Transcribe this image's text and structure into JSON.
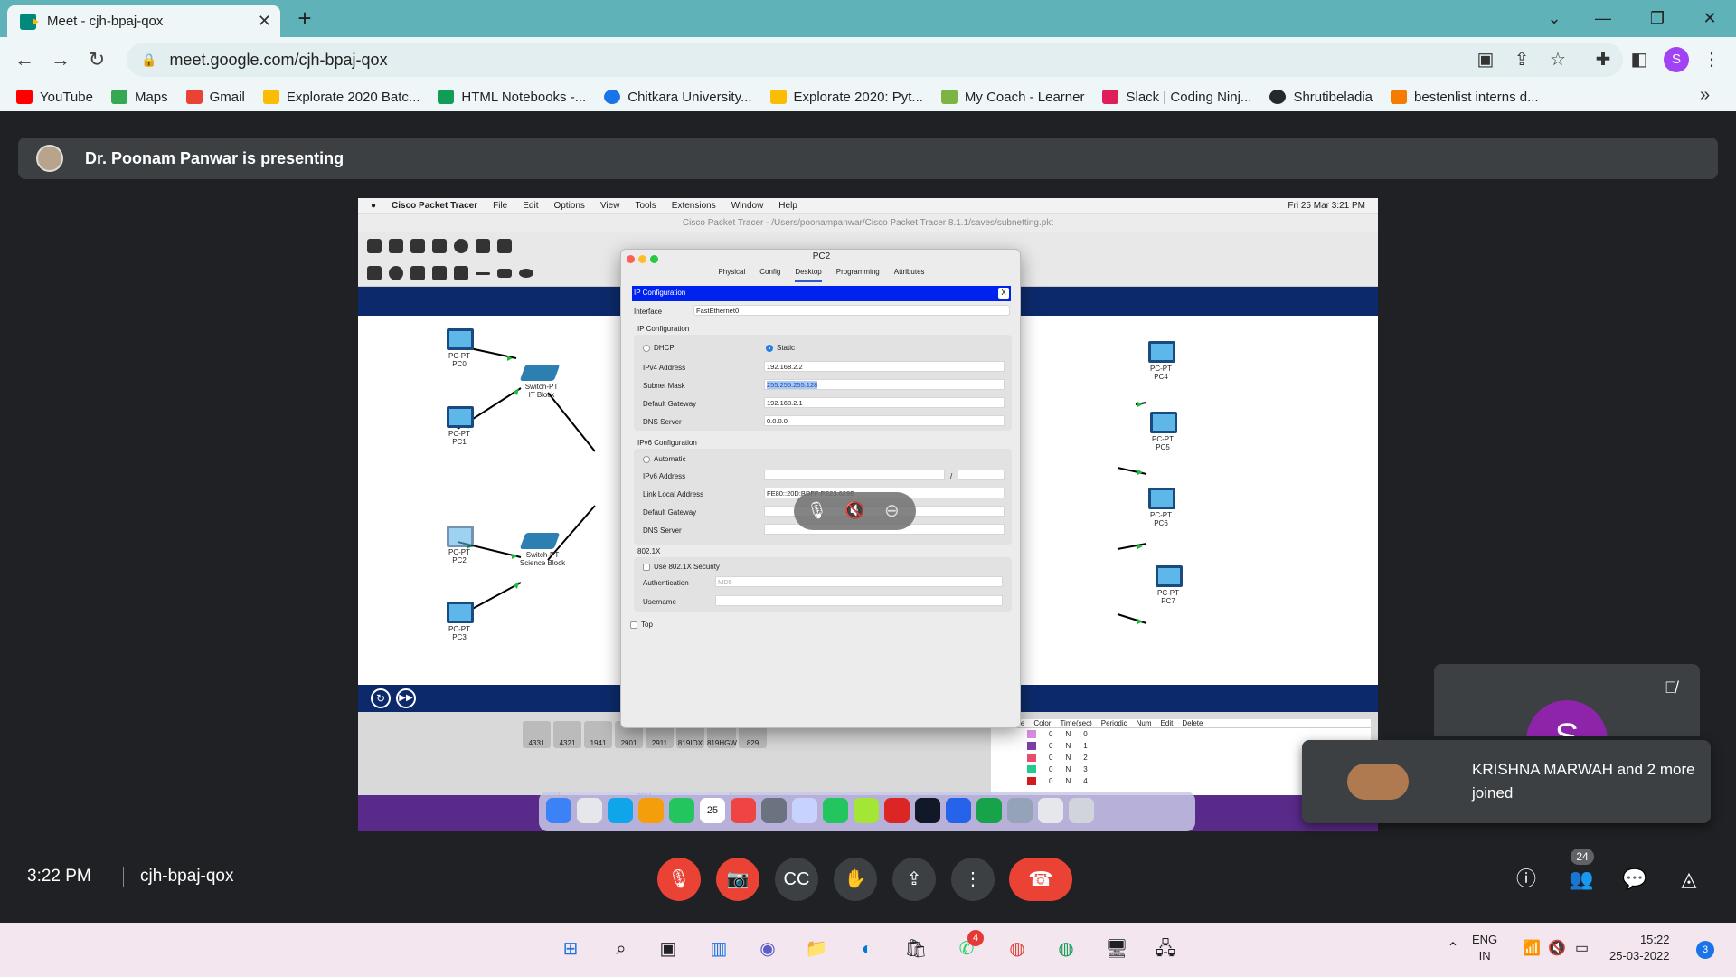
{
  "browser": {
    "tab_title": "Meet - cjh-bpaj-qox",
    "url": "meet.google.com/cjh-bpaj-qox",
    "profile_initial": "S",
    "bookmarks": [
      "YouTube",
      "Maps",
      "Gmail",
      "Explorate 2020 Batc...",
      "HTML Notebooks -...",
      "Chitkara University...",
      "Explorate 2020: Pyt...",
      "My Coach - Learner",
      "Slack | Coding Ninj...",
      "Shrutibeladia",
      "bestenlist interns d..."
    ]
  },
  "meet": {
    "presenting_text": "Dr. Poonam Panwar is presenting",
    "time": "3:22 PM",
    "meeting_code": "cjh-bpaj-qox",
    "participant_count": "24",
    "self_initial": "S",
    "toast": "KRISHNA MARWAH and 2 more joined"
  },
  "shared_screen": {
    "mac_menu": [
      "Cisco Packet Tracer",
      "File",
      "Edit",
      "Options",
      "View",
      "Tools",
      "Extensions",
      "Window",
      "Help"
    ],
    "mac_clock": "Fri 25 Mar  3:21 PM",
    "window_title": "Cisco Packet Tracer - /Users/poonampanwar/Cisco Packet Tracer 8.1.1/saves/subnetting.pkt",
    "devices": {
      "pc0": "PC-PT\nPC0",
      "pc1": "PC-PT\nPC1",
      "pc2": "PC-PT\nPC2",
      "pc3": "PC-PT\nPC3",
      "pc4": "PC-PT\nPC4",
      "pc5": "PC-PT\nPC5",
      "pc6": "PC-PT\nPC6",
      "pc7": "PC-PT\nPC7",
      "switch1": "Switch-PT\nIT Block",
      "switch2": "Switch-PT\nScience Block"
    },
    "device_models": [
      "4331",
      "4321",
      "1941",
      "2901",
      "2911",
      "819IOX",
      "819HGW",
      "829"
    ],
    "selected_model": "2911",
    "pdu_headers": [
      "Type",
      "Color",
      "Time(sec)",
      "Periodic",
      "Num",
      "Edit",
      "Delete"
    ],
    "pdu_rows": [
      {
        "time": "0",
        "periodic": "N",
        "num": "0",
        "color": "#d98ee0"
      },
      {
        "time": "0",
        "periodic": "N",
        "num": "1",
        "color": "#7b3fa6"
      },
      {
        "time": "0",
        "periodic": "N",
        "num": "2",
        "color": "#e94b6a"
      },
      {
        "time": "0",
        "periodic": "N",
        "num": "3",
        "color": "#1fcc8e"
      },
      {
        "time": "0",
        "periodic": "N",
        "num": "4",
        "color": "#d11a1a"
      }
    ],
    "dialog": {
      "title": "PC2",
      "tabs": [
        "Physical",
        "Config",
        "Desktop",
        "Programming",
        "Attributes"
      ],
      "active_tab": "Desktop",
      "header": "IP Configuration",
      "close": "X",
      "interface_label": "Interface",
      "interface_value": "FastEthernet0",
      "ipv4_section": "IP Configuration",
      "dhcp": "DHCP",
      "static": "Static",
      "ipv4_label": "IPv4 Address",
      "ipv4_value": "192.168.2.2",
      "mask_label": "Subnet Mask",
      "mask_value": "255.255.255.128",
      "gw_label": "Default Gateway",
      "gw_value": "192.168.2.1",
      "dns_label": "DNS Server",
      "dns_value": "0.0.0.0",
      "ipv6_section": "IPv6 Configuration",
      "auto": "Automatic",
      "ipv6_label": "IPv6 Address",
      "lla_label": "Link Local Address",
      "lla_value": "FE80::20D:BDFF:FE23:629E",
      "gw6_label": "Default Gateway",
      "dns6_label": "DNS Server",
      "dot1x_section": "802.1X",
      "dot1x_check": "Use 802.1X Security",
      "auth_label": "Authentication",
      "auth_value": "MD5",
      "user_label": "Username",
      "top_check": "Top",
      "slash": "/"
    },
    "dock_calendar": "25"
  },
  "taskbar": {
    "lang": "ENG\nIN",
    "time": "15:22",
    "date": "25-03-2022",
    "notifications": "3",
    "whatsapp_badge": "4"
  }
}
